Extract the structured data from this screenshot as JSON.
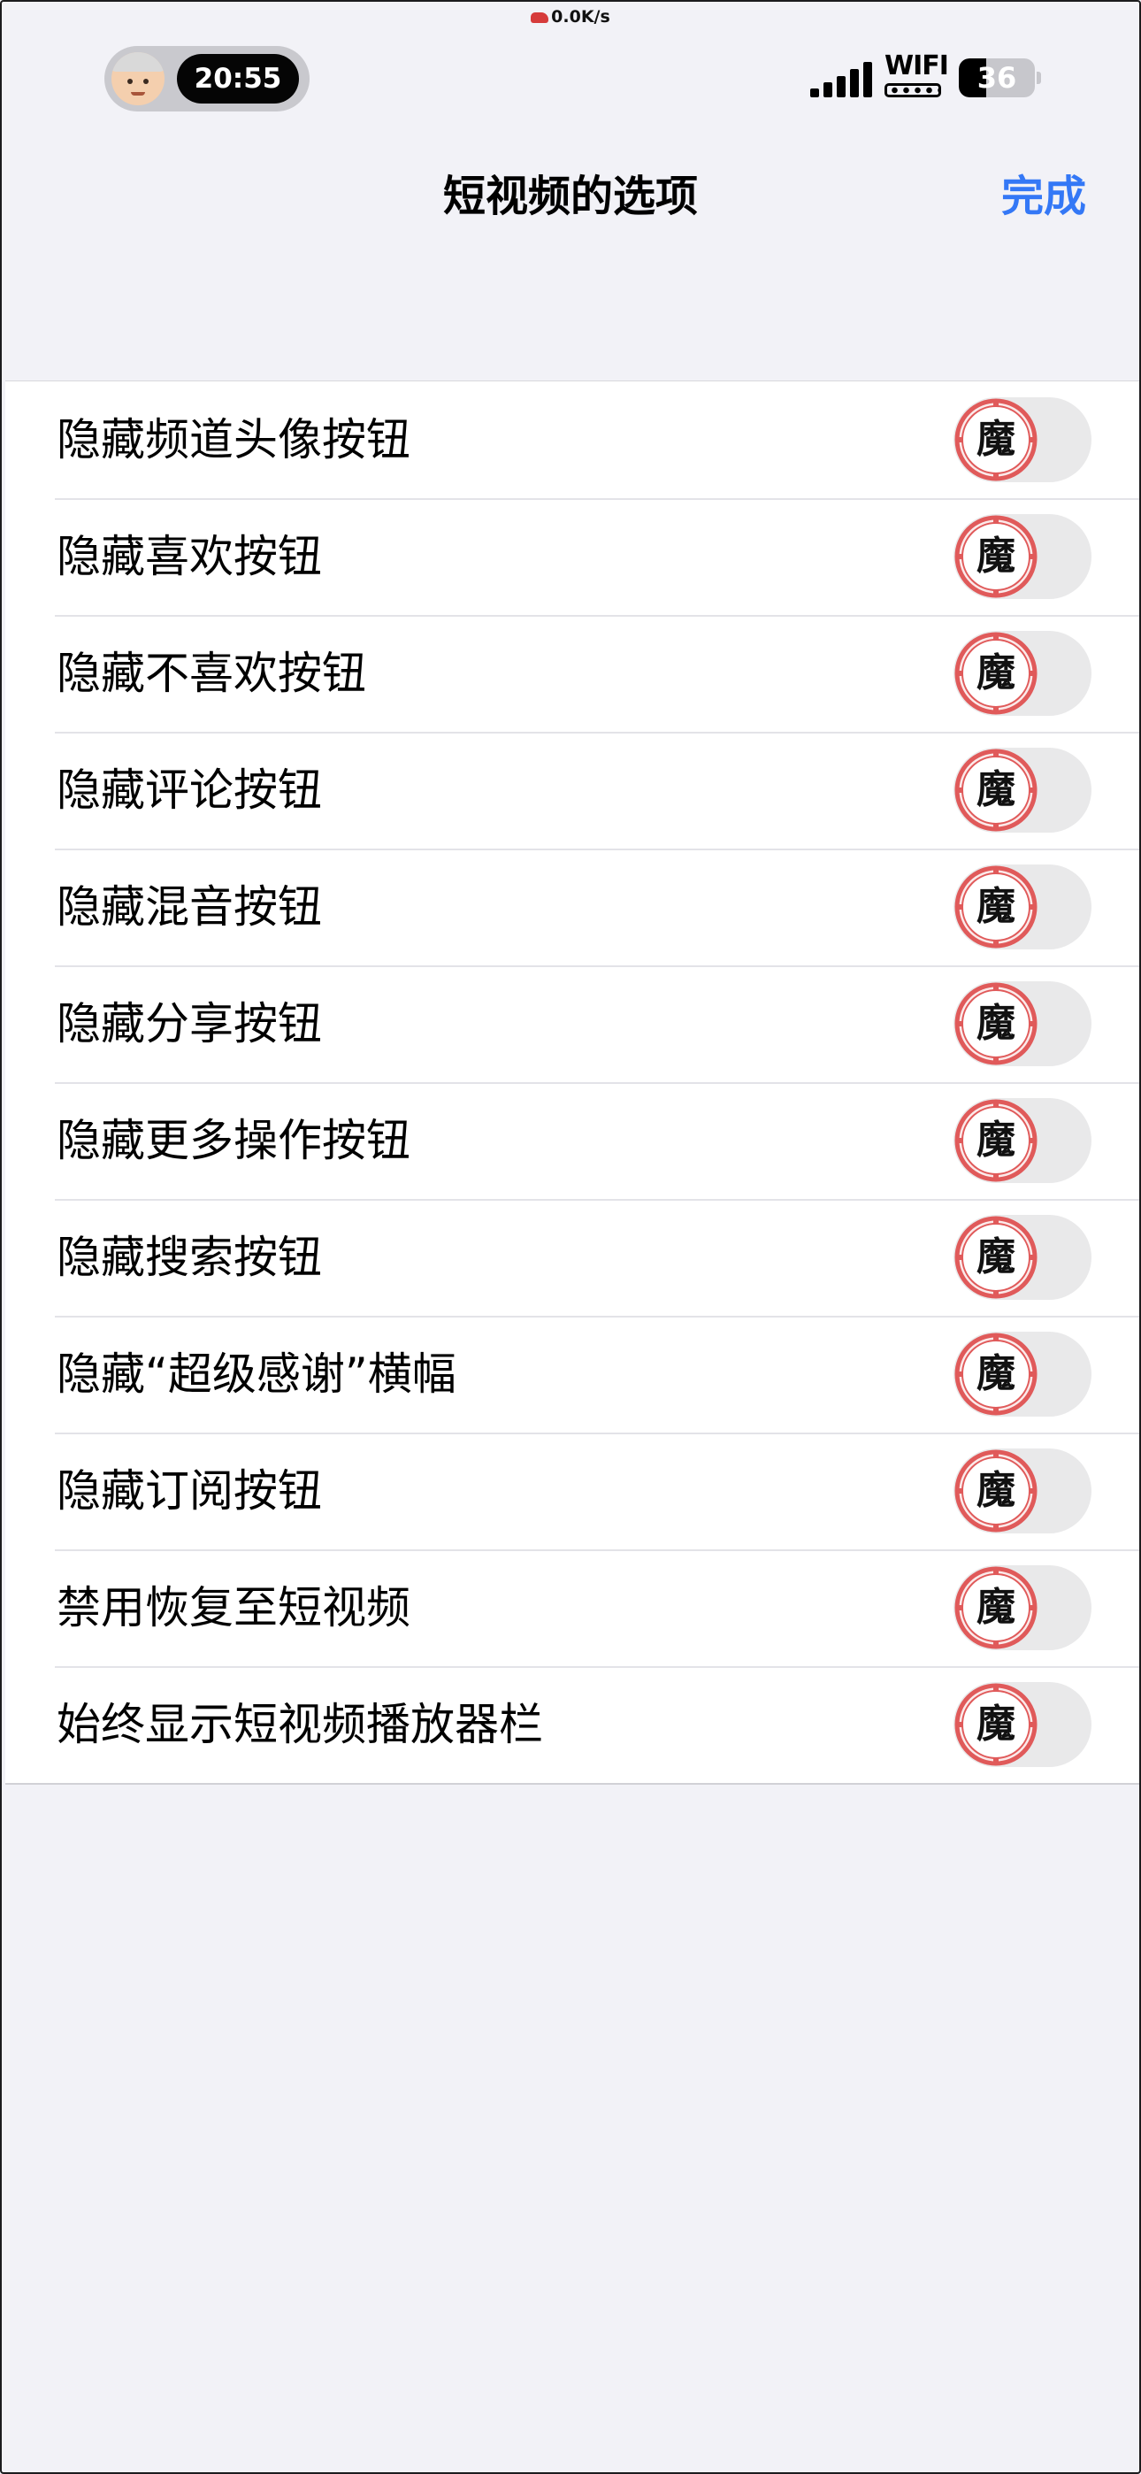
{
  "status_bar": {
    "net_speed": "0.0K/s",
    "time": "20:55",
    "wifi_label": "WIFI",
    "battery_level": "36",
    "battery_fraction": 0.36
  },
  "nav": {
    "title": "短视频的选项",
    "done_label": "完成"
  },
  "toggle_knob_glyph": "魔",
  "colors": {
    "accent": "#3478f6",
    "toggle_off_track": "#e9e9ea",
    "knob_ring": "#e05a5a",
    "background": "#f2f2f7"
  },
  "options": [
    {
      "label": "隐藏频道头像按钮",
      "on": false
    },
    {
      "label": "隐藏喜欢按钮",
      "on": false
    },
    {
      "label": "隐藏不喜欢按钮",
      "on": false
    },
    {
      "label": "隐藏评论按钮",
      "on": false
    },
    {
      "label": "隐藏混音按钮",
      "on": false
    },
    {
      "label": "隐藏分享按钮",
      "on": false
    },
    {
      "label": "隐藏更多操作按钮",
      "on": false
    },
    {
      "label": "隐藏搜索按钮",
      "on": false
    },
    {
      "label": "隐藏“超级感谢”横幅",
      "on": false
    },
    {
      "label": "隐藏订阅按钮",
      "on": false
    },
    {
      "label": "禁用恢复至短视频",
      "on": false
    },
    {
      "label": "始终显示短视频播放器栏",
      "on": false
    }
  ]
}
